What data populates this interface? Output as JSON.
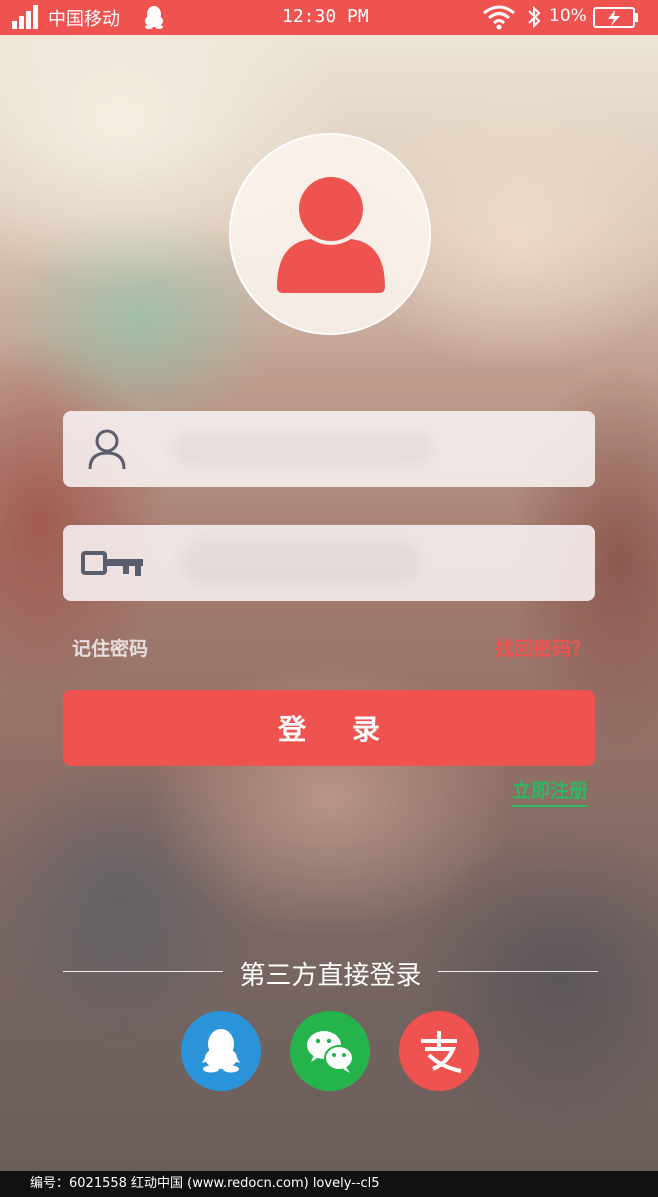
{
  "status_bar": {
    "carrier": "中国移动",
    "time": "12:30 PM",
    "battery": "10%"
  },
  "login_form": {
    "username_placeholder": "",
    "password_placeholder": "",
    "remember_label": "记住密码",
    "forgot_label": "找回密码？",
    "login_button": "登 录",
    "register_link": "立即注册"
  },
  "third_party": {
    "title": "第三方直接登录",
    "providers": [
      "qq-icon",
      "wechat-icon",
      "alipay-icon"
    ]
  },
  "footer": {
    "text": "编号：6021558    红动中国 (www.redocn.com)    lovely--cl5"
  },
  "colors": {
    "accent": "#ef5350",
    "qq": "#2b93d8",
    "wechat": "#25b44c",
    "alipay": "#ef5350",
    "register": "#2db861"
  }
}
